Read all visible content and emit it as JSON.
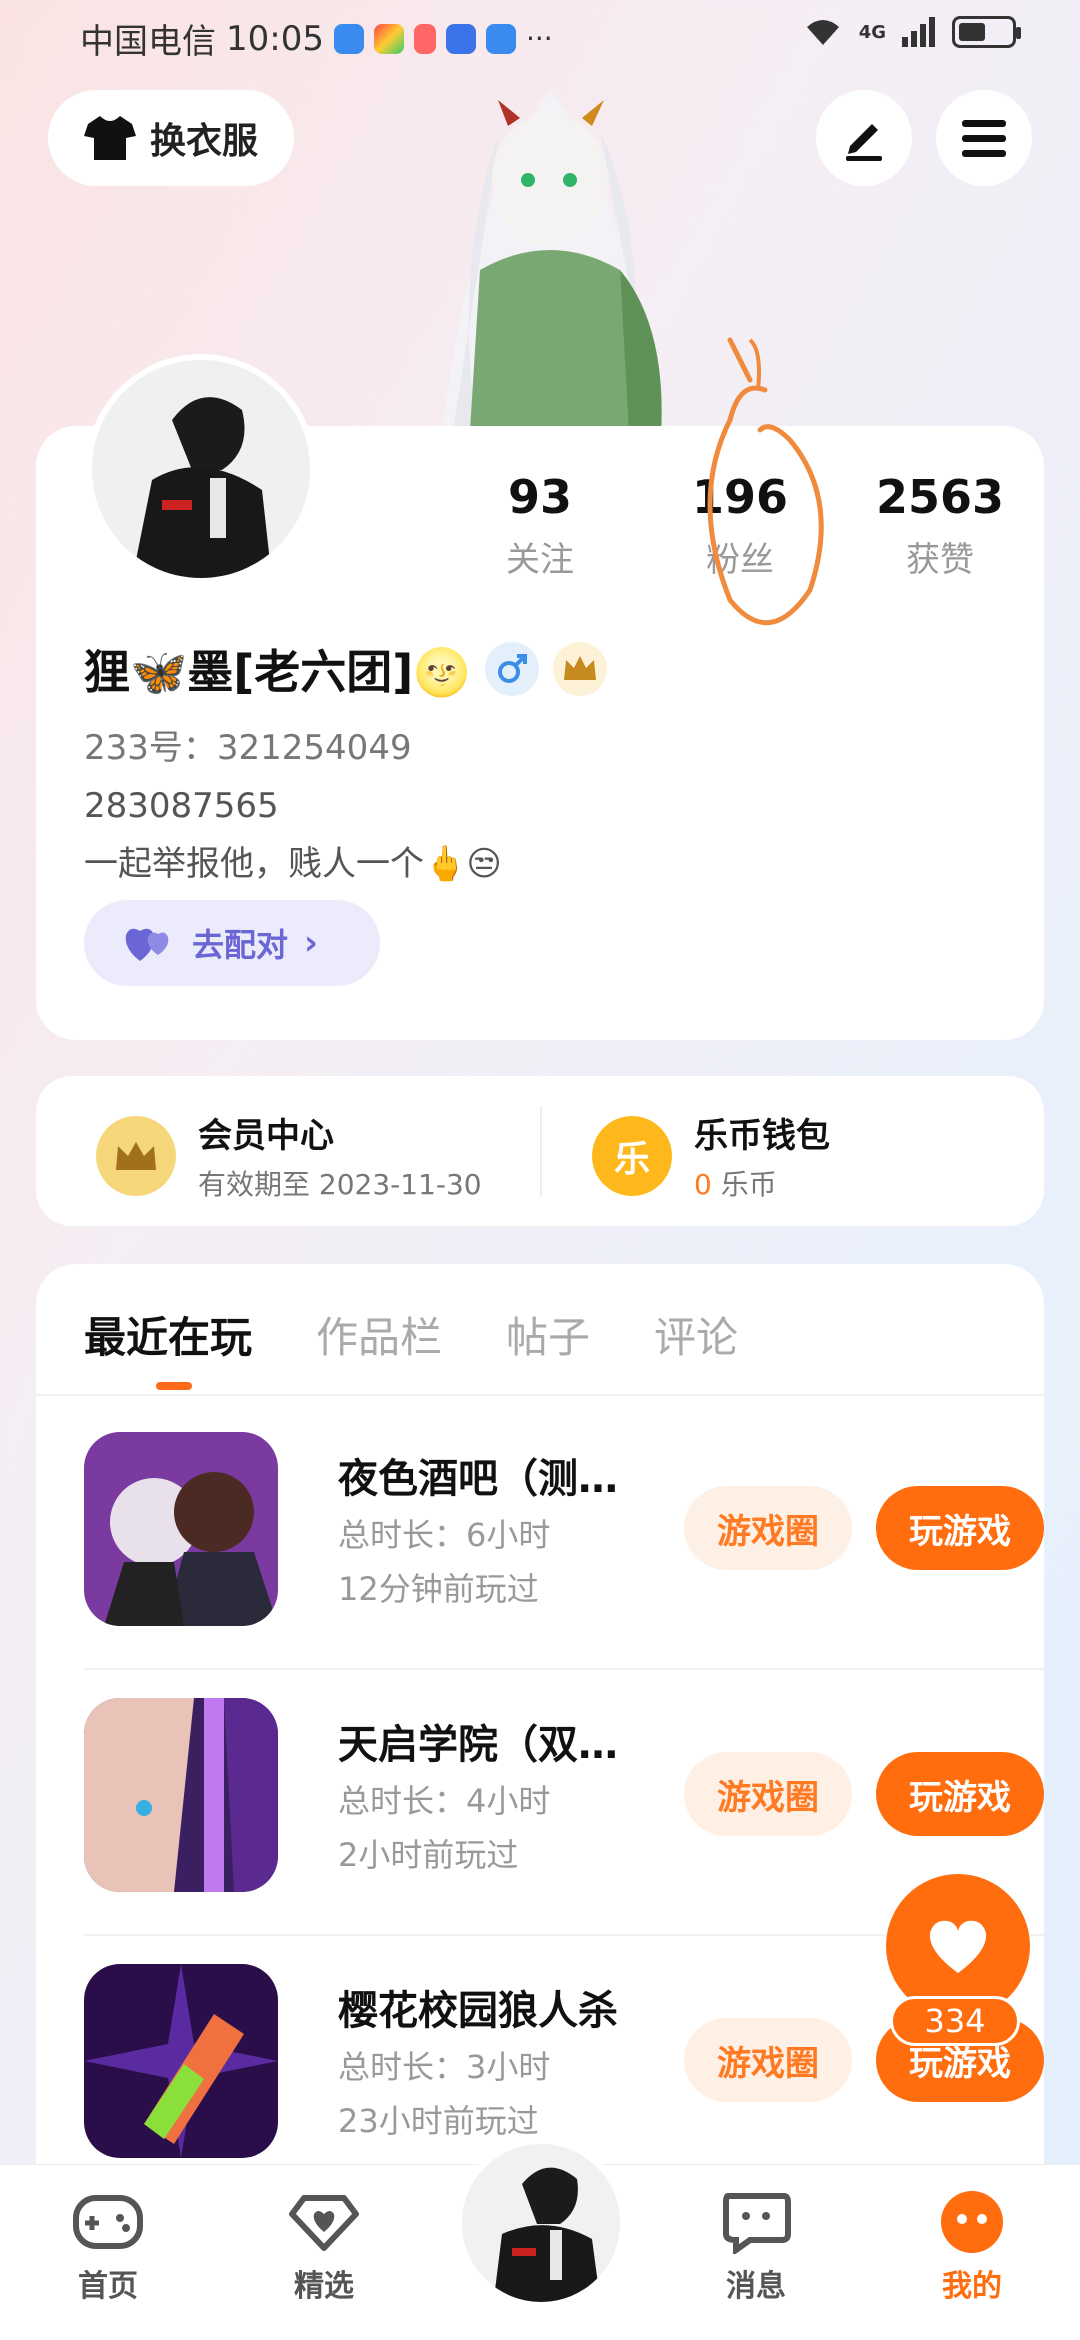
{
  "status_bar": {
    "carrier": "中国电信",
    "time": "10:05",
    "signal": "4G"
  },
  "header": {
    "outfit_label": "换衣服",
    "edit_icon": "pen-icon",
    "menu_icon": "menu-icon"
  },
  "profile": {
    "stats": [
      {
        "value": "93",
        "label": "关注"
      },
      {
        "value": "196",
        "label": "粉丝"
      },
      {
        "value": "2563",
        "label": "获赞"
      }
    ],
    "name": "狸🦋墨[老六团]🌝",
    "uid": "233号：321254049",
    "bio_line1": "283087565",
    "bio_line2": "一起举报他，贱人一个🖕😒",
    "match_label": "去配对"
  },
  "membership": {
    "vip_title": "会员中心",
    "vip_sub": "有效期至 2023-11-30",
    "wallet_title": "乐币钱包",
    "wallet_amount": "0",
    "wallet_unit": "乐币",
    "wallet_icon_char": "乐"
  },
  "tabs": [
    "最近在玩",
    "作品栏",
    "帖子",
    "评论"
  ],
  "games": [
    {
      "title": "夜色酒吧（测…",
      "duration": "总时长：6小时",
      "last_played": "12分钟前玩过",
      "circle_label": "游戏圈",
      "play_label": "玩游戏"
    },
    {
      "title": "天启学院（双…",
      "duration": "总时长：4小时",
      "last_played": "2小时前玩过",
      "circle_label": "游戏圈",
      "play_label": "玩游戏"
    },
    {
      "title": "樱花校园狼人杀",
      "duration": "总时长：3小时",
      "last_played": "23小时前玩过",
      "circle_label": "游戏圈",
      "play_label": "玩游戏"
    }
  ],
  "like_float": {
    "count": "334"
  },
  "nav": [
    {
      "label": "首页",
      "icon": "gamepad-icon"
    },
    {
      "label": "精选",
      "icon": "heart-diamond-icon"
    },
    {
      "label": "消息",
      "icon": "chat-icon"
    },
    {
      "label": "我的",
      "icon": "profile-icon"
    }
  ],
  "colors": {
    "accent": "#ff6d0f",
    "match": "#6b66d6"
  }
}
